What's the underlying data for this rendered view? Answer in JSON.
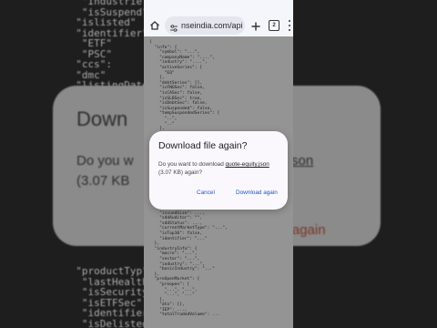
{
  "browser": {
    "url": "nseindia.com/api",
    "tab_count": "2",
    "icons": [
      "home-icon",
      "site-settings-icon",
      "plus-icon",
      "tabs-icon",
      "more-vert-icon"
    ]
  },
  "dialog": {
    "title": "Download file again?",
    "body_prefix": "Do you want to download",
    "file_name": "quote-equity.json",
    "body_suffix": "(3.07 KB) again?",
    "cancel_label": "Cancel",
    "confirm_label": "Download again"
  },
  "background": {
    "big_title": "Down",
    "big_text_left": "Do you w\n(3.07 KB",
    "big_link": "ty.json",
    "big_action": "ad again"
  },
  "colors": {
    "accent": "#1a57c4",
    "dialog_bg": "#fbf8fd",
    "toolbar_bg": "#f4f6fb"
  }
}
